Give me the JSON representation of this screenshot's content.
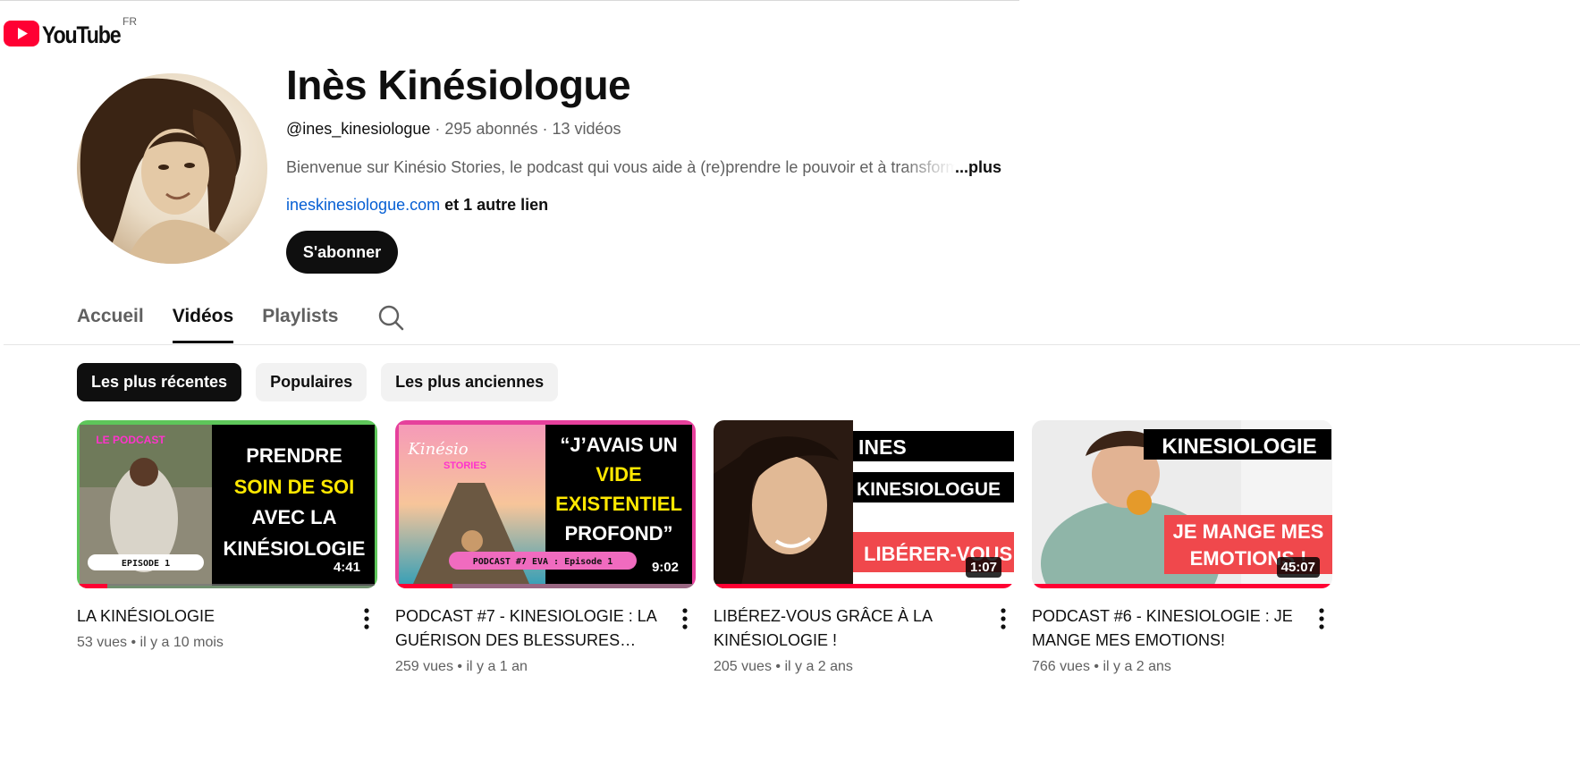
{
  "logo": {
    "name": "YouTube",
    "country": "FR"
  },
  "channel": {
    "name": "Inès Kinésiologue",
    "handle": "@ines_kinesiologue",
    "subscribers": "295 abonnés",
    "videos": "13 vidéos",
    "separator": " · ",
    "description": "Bienvenue sur Kinésio Stories, le podcast qui vous aide à (re)prendre le pouvoir et à transformer",
    "more": "...plus",
    "link": "ineskinesiologue.com",
    "other_links": " et 1 autre lien",
    "subscribe_label": "S'abonner"
  },
  "tabs": [
    {
      "label": "Accueil",
      "active": false
    },
    {
      "label": "Vidéos",
      "active": true
    },
    {
      "label": "Playlists",
      "active": false
    }
  ],
  "chips": [
    {
      "label": "Les plus récentes",
      "active": true
    },
    {
      "label": "Populaires",
      "active": false
    },
    {
      "label": "Les plus anciennes",
      "active": false
    }
  ],
  "videos": [
    {
      "title": "LA KINÉSIOLOGIE",
      "views": "53 vues",
      "age": "il y a 10 mois",
      "duration": "4:41",
      "progress": 0.1,
      "thumb_text": [
        "PRENDRE",
        "SOIN DE SOI",
        "AVEC LA",
        "KINÉSIOLOGIE"
      ],
      "thumb_badge": "LE PODCAST",
      "thumb_episode": "EPISODE 1"
    },
    {
      "title": "PODCAST #7 - KINESIOLOGIE : LA GUÉRISON DES BLESSURES…",
      "views": "259 vues",
      "age": "il y a 1 an",
      "duration": "9:02",
      "progress": 0.19,
      "thumb_text": [
        "“J’AVAIS UN",
        "VIDE",
        "EXISTENTIEL",
        "PROFOND”"
      ],
      "thumb_badge": "Kinésio",
      "thumb_badge2": "STORIES",
      "thumb_episode": "PODCAST #7 EVA : Episode 1"
    },
    {
      "title": "LIBÉREZ-VOUS GRÂCE À LA KINÉSIOLOGIE !",
      "views": "205 vues",
      "age": "il y a 2 ans",
      "duration": "1:07",
      "progress": 1,
      "thumb_text": [
        "INES",
        "KINESIOLOGUE",
        "LIBÉRER-VOUS !"
      ]
    },
    {
      "title": "PODCAST #6 - KINESIOLOGIE : JE MANGE MES EMOTIONS!",
      "views": "766 vues",
      "age": "il y a 2 ans",
      "duration": "45:07",
      "progress": 1,
      "thumb_text": [
        "KINESIOLOGIE",
        "JE MANGE MES",
        "EMOTIONS !"
      ]
    }
  ],
  "view_separator": " • ",
  "colors": {
    "accent_red": "#ff0033",
    "link": "#065fd4",
    "thumb_green": "#5ec65a",
    "thumb_pink": "#e6409c",
    "thumb_yellow": "#ffe800"
  }
}
